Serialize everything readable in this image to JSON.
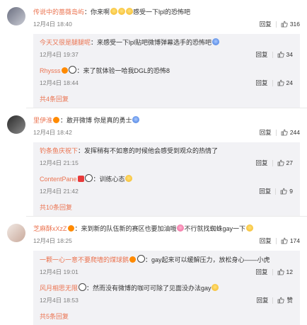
{
  "comments": [
    {
      "user": "传说中的蔷薇岛屿",
      "text": "：你来啊",
      "text_tail": "感受一下lpl的恐怖吧",
      "time": "12月4日 18:40",
      "reply_label": "回复",
      "likes": "316",
      "replies": [
        {
          "user": "今天又很是腿腿呢",
          "text": "：来感受一下lpl贴吧微博弹幕选手的恐怖吧",
          "time": "12月4日 19:37",
          "reply_label": "回复",
          "likes": "34"
        },
        {
          "user": "Rhysss",
          "text": "：来了就体验一哈我DGL的恐怖8",
          "time": "12月4日 18:44",
          "reply_label": "回复",
          "likes": "24"
        }
      ],
      "more": "共4条回复"
    },
    {
      "user": "里伊淮",
      "text": "：敢开微博 你是真的勇士",
      "time": "12月4日 18:42",
      "reply_label": "回复",
      "likes": "244",
      "replies": [
        {
          "user": "钓条鱼庆祝下",
          "text": "：发挥稍有不如意的时候他会感受到观众的热情了",
          "time": "12月4日 21:15",
          "reply_label": "回复",
          "likes": "27"
        },
        {
          "user": "ContentPane",
          "text": "：训练心态",
          "time": "12月4日 21:42",
          "reply_label": "回复",
          "likes": "9"
        }
      ],
      "more": "共10条回复"
    },
    {
      "user": "芝麻酥xXzZ",
      "text": "：来到新的队伍新的赛区也要加油哦",
      "text_tail": "不行就找蜘蛛gay一下",
      "time": "12月4日 18:25",
      "reply_label": "回复",
      "likes": "174",
      "replies": [
        {
          "user": "一颗一心一意不要爬墙的煤球鹅",
          "text": "：gay起来可以缓解压力，放松身心——小虎",
          "time": "12月4日 19:01",
          "reply_label": "回复",
          "likes": "12"
        },
        {
          "user": "风月相思无限",
          "text": "：然而没有微博的咖可可除了见面没办法gay",
          "time": "12月4日 18:53",
          "reply_label": "回复",
          "likes": "赞"
        }
      ],
      "more": "共5条回复"
    }
  ],
  "icons": {
    "thumb": "thumbs-up-icon"
  },
  "colors": {
    "username": "#eb7350",
    "reply_bg": "#f2f2f5",
    "meta": "#808080"
  }
}
